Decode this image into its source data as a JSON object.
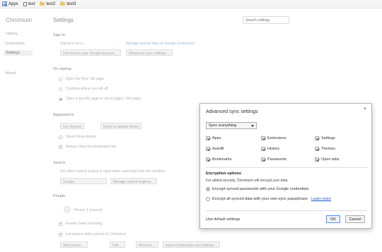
{
  "bookmarks": [
    "Apps",
    "test",
    "test2",
    "test3"
  ],
  "sidebar": {
    "brand": "Chromium",
    "items": [
      "History",
      "Extensions",
      "Settings",
      "About"
    ]
  },
  "settings": {
    "title": "Settings",
    "search_placeholder": "Search settings",
    "signin_heading": "Sign in",
    "signin_text": "Signed in as a…",
    "signin_manage": "Manage synced data on Google Dashboard",
    "disconnect_btn": "Disconnect your Google Account…",
    "advanced_btn": "Advanced sync settings…",
    "startup_heading": "On startup",
    "startup_opts": [
      "Open the New Tab page",
      "Continue where you left off",
      "Open a specific page or set of pages. Set pages"
    ],
    "appearance_heading": "Appearance",
    "appearance_btn1": "Get themes",
    "appearance_btn2": "Reset to default theme",
    "appearance_opts": [
      "Show Home button",
      "Always show the bookmarks bar"
    ],
    "search_heading": "Search",
    "search_text": "Set which search engine is used when searching from the omnibox.",
    "search_engine": "Google",
    "manage_engines_btn": "Manage search engines…",
    "people_heading": "People",
    "people_user": "Person 1 (current)",
    "people_opts": [
      "Enable Guest browsing",
      "Let anyone add a person to Chromium"
    ],
    "people_btns": [
      "Add person…",
      "Edit…",
      "Remove…",
      "Import bookmarks and settings…"
    ]
  },
  "dialog": {
    "title": "Advanced sync settings",
    "close_icon": "×",
    "sync_select": "Sync everything",
    "items": [
      {
        "label": "Apps",
        "checked": true
      },
      {
        "label": "Extensions",
        "checked": true
      },
      {
        "label": "Settings",
        "checked": true
      },
      {
        "label": "Autofill",
        "checked": true
      },
      {
        "label": "History",
        "checked": true
      },
      {
        "label": "Themes",
        "checked": true
      },
      {
        "label": "Bookmarks",
        "checked": true
      },
      {
        "label": "Passwords",
        "checked": true
      },
      {
        "label": "Open tabs",
        "checked": true
      }
    ],
    "encryption_title": "Encryption options",
    "encryption_desc": "For added security, Chromium will encrypt your data.",
    "option1": "Encrypt synced passwords with your Google credentials",
    "option2": "Encrypt all synced data with your own sync passphrase",
    "learn_more": "Learn more",
    "use_default": "Use default settings",
    "ok": "OK",
    "cancel": "Cancel"
  }
}
